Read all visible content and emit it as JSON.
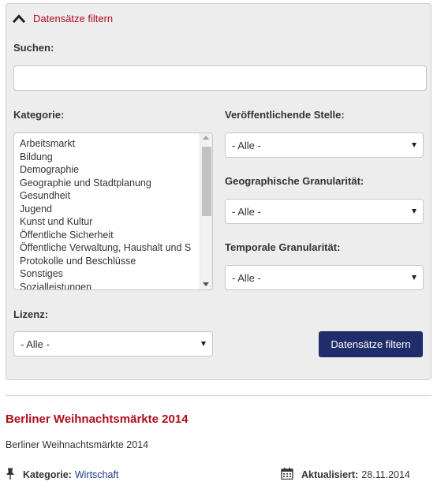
{
  "filter_panel": {
    "title": "Datensätze filtern",
    "search_label": "Suchen:",
    "search_value": "",
    "search_placeholder": "",
    "category_label": "Kategorie:",
    "categories": [
      "Arbeitsmarkt",
      "Bildung",
      "Demographie",
      "Geographie und Stadtplanung",
      "Gesundheit",
      "Jugend",
      "Kunst und Kultur",
      "Öffentliche Sicherheit",
      "Öffentliche Verwaltung, Haushalt und S",
      "Protokolle und Beschlüsse",
      "Sonstiges",
      "Sozialleistungen"
    ],
    "publisher_label": "Veröffentlichende Stelle:",
    "publisher_value": "- Alle -",
    "geo_label": "Geographische Granularität:",
    "geo_value": "- Alle -",
    "temporal_label": "Temporale Granularität:",
    "temporal_value": "- Alle -",
    "license_label": "Lizenz:",
    "license_value": "- Alle -",
    "submit_label": "Datensätze filtern"
  },
  "result": {
    "title": "Berliner Weihnachtsmärkte 2014",
    "description": "Berliner Weihnachtsmärkte 2014",
    "category_label": "Kategorie:",
    "category_value": "Wirtschaft",
    "updated_label": "Aktualisiert:",
    "updated_value": "28.11.2014"
  },
  "colors": {
    "accent_red": "#b00d1a",
    "button_navy": "#1f2d6b",
    "link_blue": "#1f3b8a",
    "panel_bg": "#ededed"
  },
  "icons": {
    "panel_toggle": "chevron-up-icon",
    "category": "pushpin-icon",
    "updated": "calendar-icon"
  }
}
